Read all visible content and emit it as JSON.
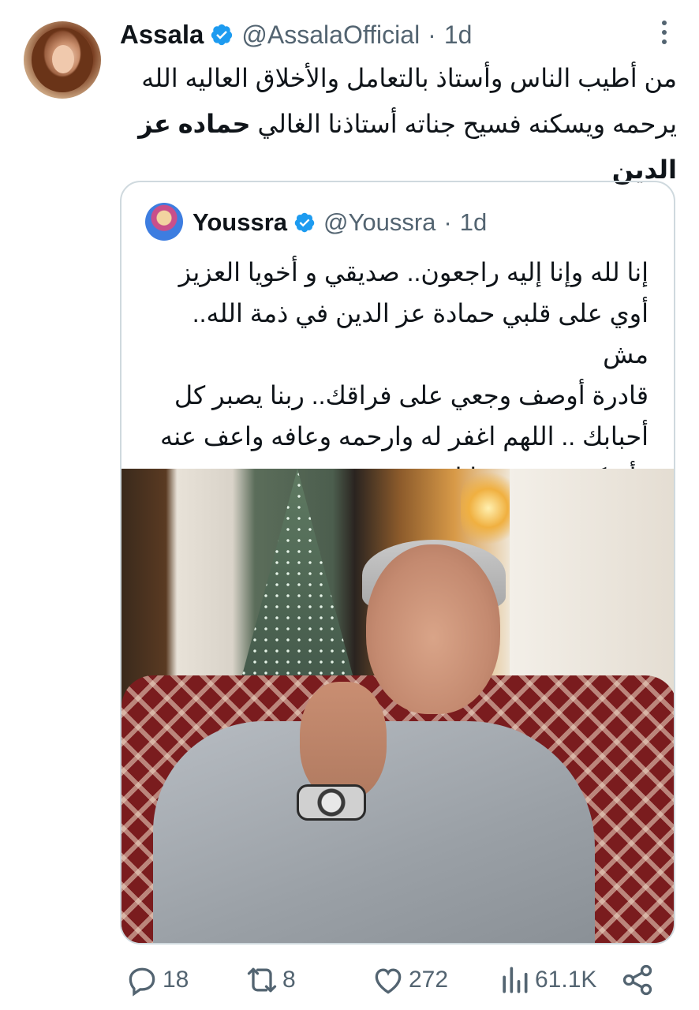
{
  "tweet": {
    "author_name": "Assala",
    "handle": "@AssalaOfficial",
    "separator": "·",
    "time": "1d",
    "text_line1": "من أطيب الناس وأستاذ بالتعامل والأخلاق العاليه الله",
    "text_line2_part1": "يرحمه ويسكنه فسيح جناته أستاذنا الغالي ",
    "text_line2_bold": "حماده عز",
    "text_line3_bold": "الدين"
  },
  "quoted_tweet": {
    "author_name": "Youssra",
    "handle": "@Youssra",
    "separator": "·",
    "time": "1d",
    "lines": [
      "إنا لله وإنا إليه راجعون.. صديقي و أخويا العزيز",
      "أوي على قلبي حمادة عز الدين في ذمة الله.. مش",
      "قادرة أوصف وجعي على فراقك.. ربنا يصبر كل",
      "أحبابك .. اللهم اغفر له وارحمه وعافه واعف عنه",
      "وأسكنه فسيح جناتك"
    ]
  },
  "actions": {
    "replies": "18",
    "retweets": "8",
    "likes": "272",
    "views": "61.1K"
  },
  "colors": {
    "verified": "#1d9bf0",
    "muted": "#536471",
    "border": "#cfd9de"
  }
}
